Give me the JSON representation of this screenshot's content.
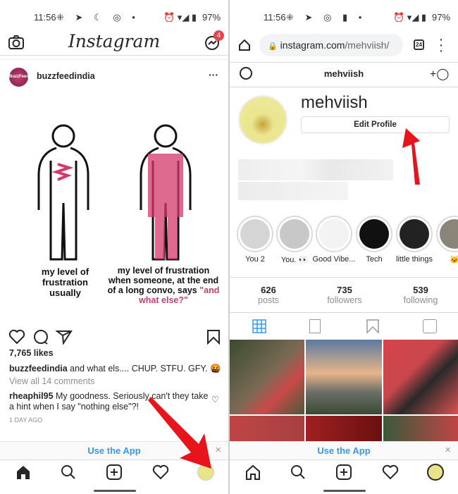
{
  "left": {
    "status": {
      "time": "11:56",
      "battery": "97%"
    },
    "header": {
      "logo": "Instagram",
      "messages_badge": "4"
    },
    "post": {
      "username": "buzzfeedindia",
      "avatar_text": "BuzzFeed",
      "image_text_left": "my level of frustration usually",
      "image_text_right_1": "my level of frustration when someone, at the end of a long convo, says",
      "image_text_right_2": "\"and what else?\"",
      "likes": "7,765 likes",
      "caption_user": "buzzfeedindia",
      "caption_text": "and what els.... CHUP. STFU. GFY. 🤬",
      "view_comments": "View all 14 comments",
      "comment_user": "rheaphil95",
      "comment_text": "My goodness. Seriously can't they take a hint when I say \"nothing else\"?!",
      "time_ago": "1 DAY AGO"
    },
    "banner": {
      "label": "Use the App",
      "close": "×"
    }
  },
  "right": {
    "status": {
      "time": "11:56",
      "battery": "97%"
    },
    "browser": {
      "url_domain": "instagram.com",
      "url_path": "/mehviish/",
      "tab_count": "24"
    },
    "header": {
      "username": "mehviish"
    },
    "profile": {
      "name": "mehviish",
      "edit_button": "Edit Profile"
    },
    "highlights": [
      {
        "label": "You 2",
        "color": "#d5d5d5"
      },
      {
        "label": "You. 👀",
        "color": "#c8c8c8"
      },
      {
        "label": "Good Vibe...",
        "color": "#f3f3f3"
      },
      {
        "label": "Tech",
        "color": "#111111"
      },
      {
        "label": "little things",
        "color": "#222222"
      },
      {
        "label": "🐱",
        "color": "#8a8578"
      }
    ],
    "stats": [
      {
        "value": "626",
        "label": "posts"
      },
      {
        "value": "735",
        "label": "followers"
      },
      {
        "value": "539",
        "label": "following"
      }
    ],
    "banner": {
      "label": "Use the App",
      "close": "×"
    }
  },
  "colors": {
    "accent": "#3897f0",
    "arrow": "#e8141b",
    "highlight_text": "#c2426d"
  }
}
